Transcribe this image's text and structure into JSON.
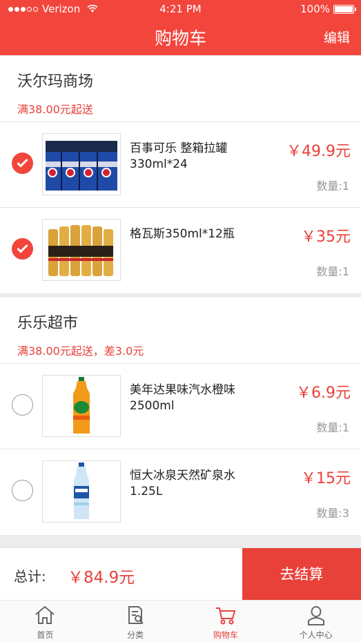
{
  "status_bar": {
    "carrier": "Verizon",
    "time": "4:21 PM",
    "battery": "100%"
  },
  "header": {
    "title": "购物车",
    "edit_label": "编辑"
  },
  "stores": [
    {
      "name": "沃尔玛商场",
      "note": "满38.00元起送",
      "items": [
        {
          "name": "百事可乐 整箱拉罐330ml*24",
          "price": "￥49.9元",
          "qty": "数量:1",
          "checked": true,
          "icon": "pepsi-cans-image"
        },
        {
          "name": "格瓦斯350ml*12瓶",
          "price": "￥35元",
          "qty": "数量:1",
          "checked": true,
          "icon": "kvass-bottles-image"
        }
      ]
    },
    {
      "name": "乐乐超市",
      "note": "满38.00元起送，差3.0元",
      "items": [
        {
          "name": "美年达果味汽水橙味2500ml",
          "price": "￥6.9元",
          "qty": "数量:1",
          "checked": false,
          "icon": "mirinda-bottle-image"
        },
        {
          "name": "恒大冰泉天然矿泉水1.25L",
          "price": "￥15元",
          "qty": "数量:3",
          "checked": false,
          "icon": "water-bottle-image"
        }
      ]
    }
  ],
  "checkout": {
    "total_label": "总计:",
    "total_value": "￥84.9元",
    "button_label": "去结算"
  },
  "tabbar": [
    {
      "label": "首页",
      "icon": "home-icon"
    },
    {
      "label": "分类",
      "icon": "category-icon"
    },
    {
      "label": "购物车",
      "icon": "cart-icon",
      "active": true
    },
    {
      "label": "个人中心",
      "icon": "profile-icon"
    }
  ],
  "colors": {
    "accent": "#f2453c",
    "price": "#e8413a"
  }
}
